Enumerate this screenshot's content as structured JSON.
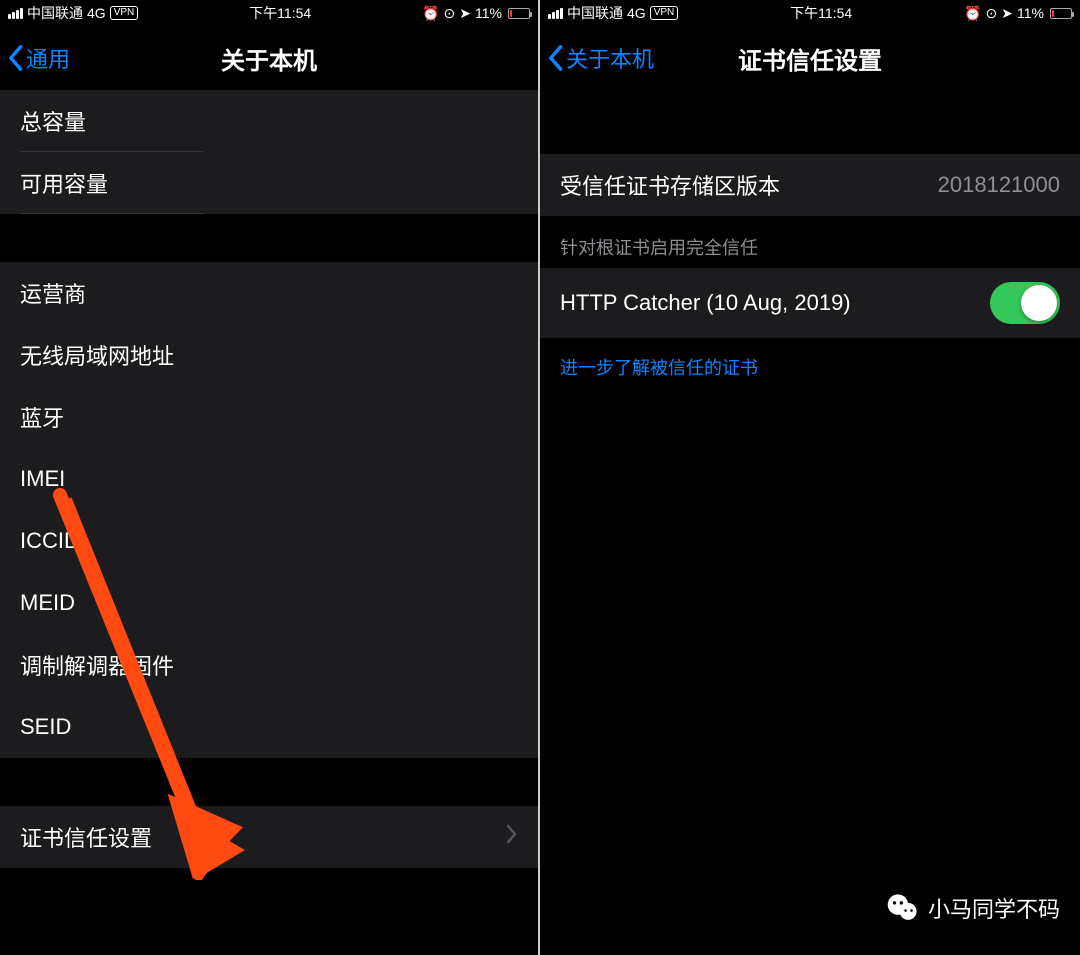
{
  "status": {
    "carrier": "中国联通",
    "network": "4G",
    "vpn_badge": "VPN",
    "time": "下午11:54",
    "battery_percent": "11%"
  },
  "left": {
    "nav_back": "通用",
    "nav_title": "关于本机",
    "rows": {
      "total_capacity": "总容量",
      "available_capacity": "可用容量",
      "carrier": "运营商",
      "wifi_addr": "无线局域网地址",
      "bluetooth": "蓝牙",
      "imei": "IMEI",
      "iccid": "ICCID",
      "meid": "MEID",
      "modem_firmware": "调制解调器固件",
      "seid": "SEID",
      "cert_trust": "证书信任设置"
    }
  },
  "right": {
    "nav_back": "关于本机",
    "nav_title": "证书信任设置",
    "trust_store_version_label": "受信任证书存储区版本",
    "trust_store_version_value": "2018121000",
    "section_header": "针对根证书启用完全信任",
    "cert_name": "HTTP Catcher (10 Aug, 2019)",
    "learn_more": "进一步了解被信任的证书"
  },
  "watermark": "小马同学不码",
  "colors": {
    "accent_blue": "#0a84ff",
    "toggle_green": "#34c759",
    "battery_low": "#ff3b30",
    "arrow": "#ff4a12"
  }
}
